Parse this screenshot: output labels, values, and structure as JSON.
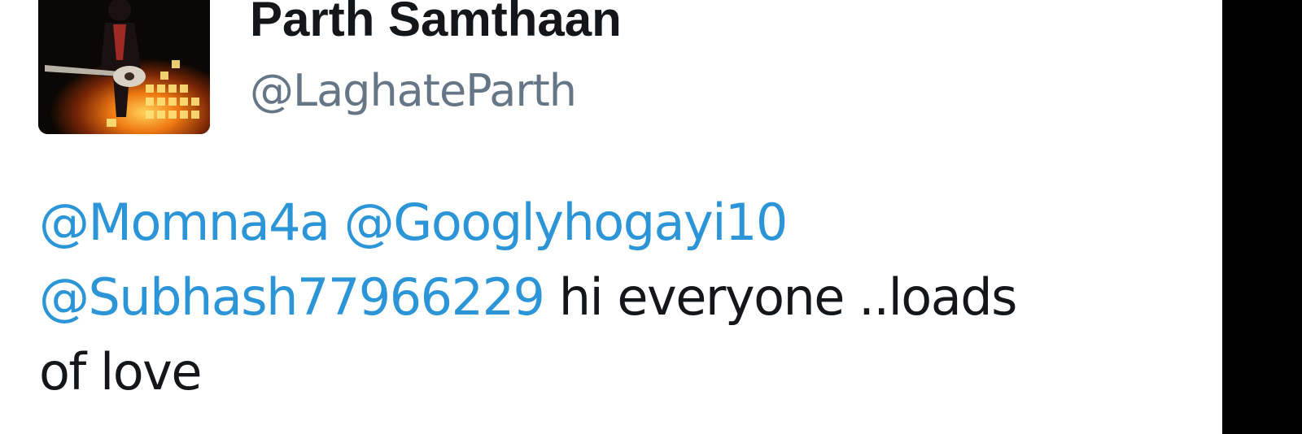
{
  "profile": {
    "display_name": "Parth Samthaan",
    "handle": "@LaghateParth",
    "avatar_icon": "profile-photo-guitarist"
  },
  "tweet": {
    "mentions": [
      "@Momna4a",
      "@Googlyhogayi10",
      "@Subhash77966229"
    ],
    "message_part_1": "hi everyone ..loads",
    "message_part_2": "of love"
  },
  "colors": {
    "mention": "#2b95d8",
    "handle": "#657786",
    "text": "#14171a",
    "background": "#ffffff"
  }
}
